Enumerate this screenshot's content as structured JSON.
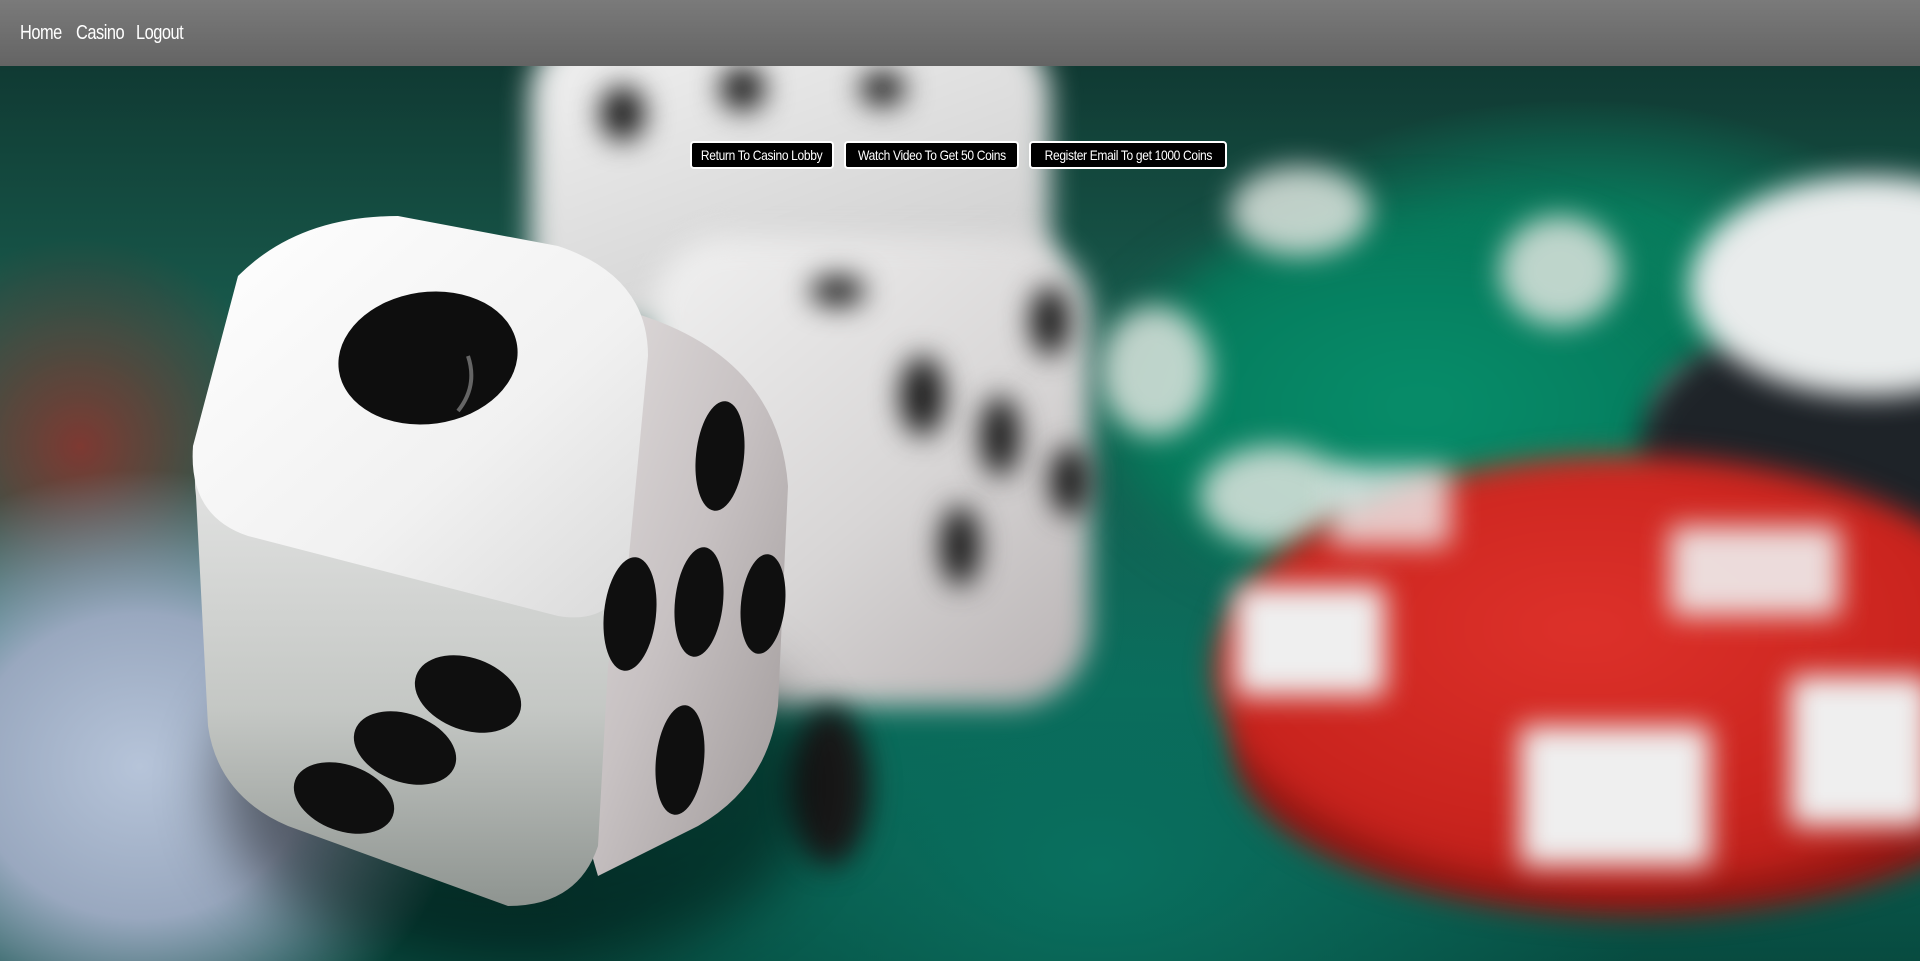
{
  "nav": {
    "items": [
      {
        "label": "Home"
      },
      {
        "label": "Casino"
      },
      {
        "label": "Logout"
      }
    ]
  },
  "actions": {
    "return_lobby": "Return To Casino Lobby",
    "watch_video": "Watch Video To Get 50 Coins",
    "register_email": "Register Email To get 1000 Coins"
  },
  "background": {
    "image": "dice-and-casino-chips-photo"
  }
}
